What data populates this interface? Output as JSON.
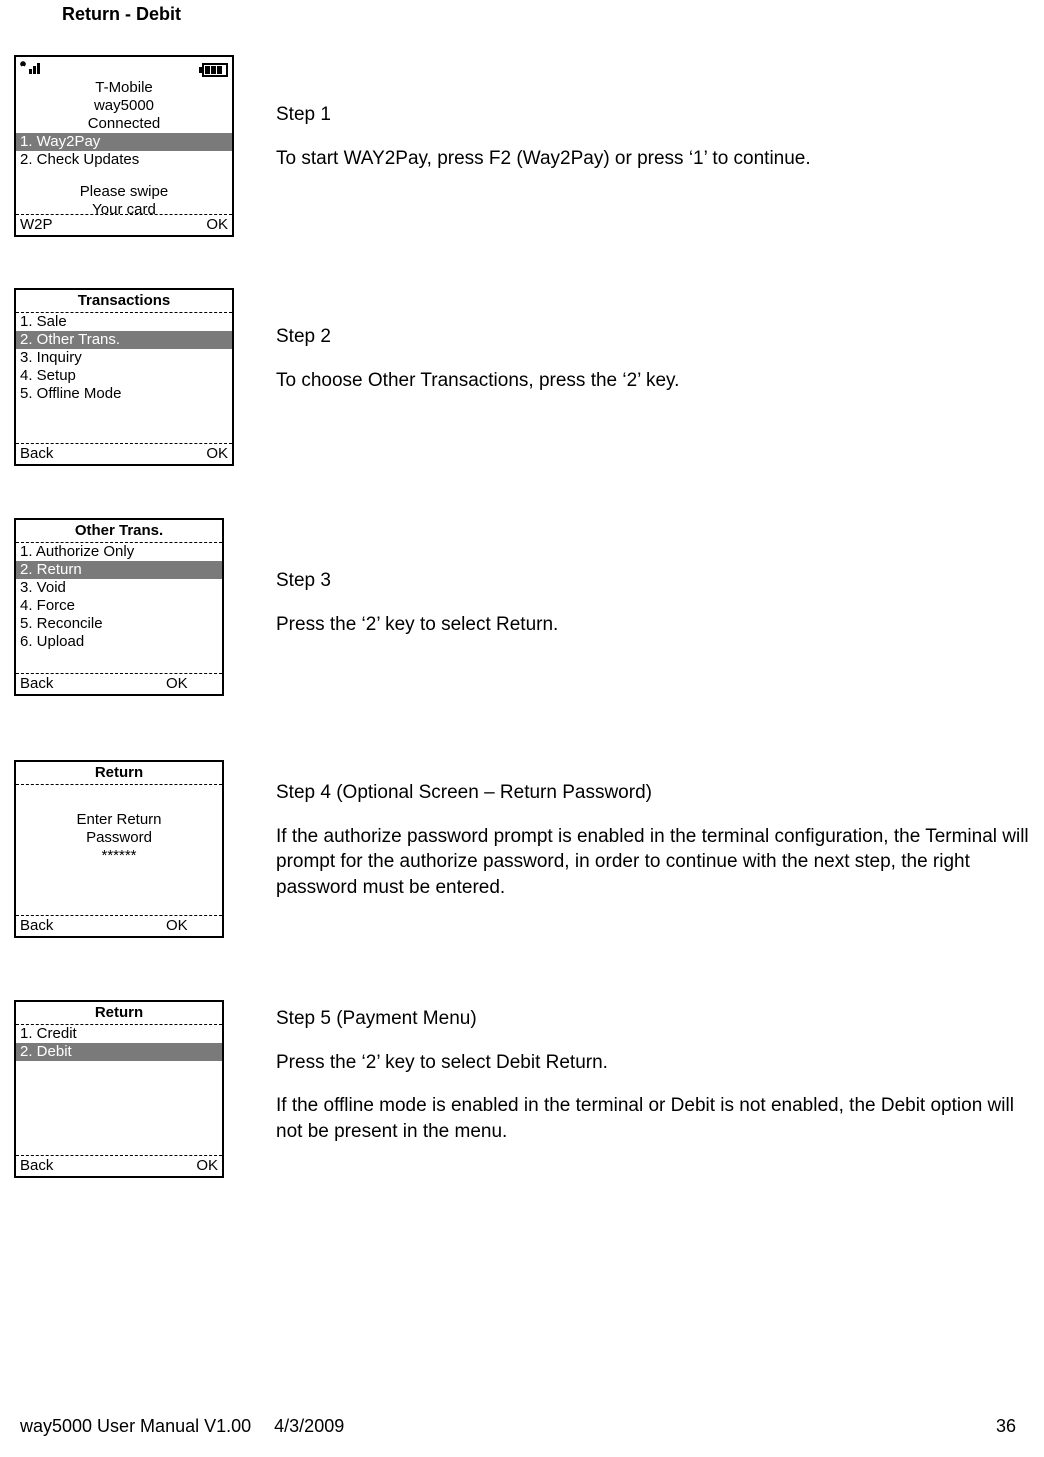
{
  "document": {
    "section_title": "Return - Debit",
    "footer": {
      "manual": "way5000 User Manual V1.00",
      "date": "4/3/2009",
      "page": "36"
    }
  },
  "screen1": {
    "carrier": "T-Mobile",
    "device": "way5000",
    "status": "Connected",
    "items": [
      {
        "label": "1. Way2Pay",
        "selected": true
      },
      {
        "label": "2. Check Updates",
        "selected": false
      }
    ],
    "swipe1": "Please swipe",
    "swipe2": "Your card",
    "footer_left": "W2P",
    "footer_right": "OK"
  },
  "screen2": {
    "title": "Transactions",
    "items": [
      {
        "label": "1. Sale",
        "selected": false
      },
      {
        "label": "2. Other Trans.",
        "selected": true
      },
      {
        "label": "3. Inquiry",
        "selected": false
      },
      {
        "label": "4. Setup",
        "selected": false
      },
      {
        "label": "5. Offline Mode",
        "selected": false
      }
    ],
    "footer_left": "Back",
    "footer_right": "OK"
  },
  "screen3": {
    "title": "Other Trans.",
    "items": [
      {
        "label": "1. Authorize Only",
        "selected": false
      },
      {
        "label": "2. Return",
        "selected": true
      },
      {
        "label": "3. Void",
        "selected": false
      },
      {
        "label": "4. Force",
        "selected": false
      },
      {
        "label": "5. Reconcile",
        "selected": false
      },
      {
        "label": "6. Upload",
        "selected": false
      }
    ],
    "footer_left": "Back",
    "footer_right": "OK"
  },
  "screen4": {
    "title": "Return",
    "line1": "Enter Return",
    "line2": "Password",
    "masked": "******",
    "footer_left": "Back",
    "footer_right": "OK"
  },
  "screen5": {
    "title": "Return",
    "items": [
      {
        "label": "1. Credit",
        "selected": false
      },
      {
        "label": "2. Debit",
        "selected": true
      }
    ],
    "footer_left": "Back",
    "footer_right": "OK"
  },
  "steps": {
    "s1_title": "Step 1",
    "s1_body": "To start WAY2Pay, press F2 (Way2Pay) or press ‘1’ to continue.",
    "s2_title": "Step 2",
    "s2_body": "To choose Other Transactions, press the ‘2’ key.",
    "s3_title": "Step 3",
    "s3_body": "Press the ‘2’ key to select Return.",
    "s4_title": "Step 4 (Optional Screen – Return Password)",
    "s4_body": "If the authorize password prompt is enabled in the terminal configuration, the Terminal will prompt for the authorize password, in order to continue with the next step, the right password must be entered.",
    "s5_title": "Step 5 (Payment Menu)",
    "s5_body1": "Press the ‘2’ key to select Debit Return.",
    "s5_body2": "If the offline mode is enabled in the terminal or Debit is not enabled, the Debit option will not be present in the menu."
  }
}
